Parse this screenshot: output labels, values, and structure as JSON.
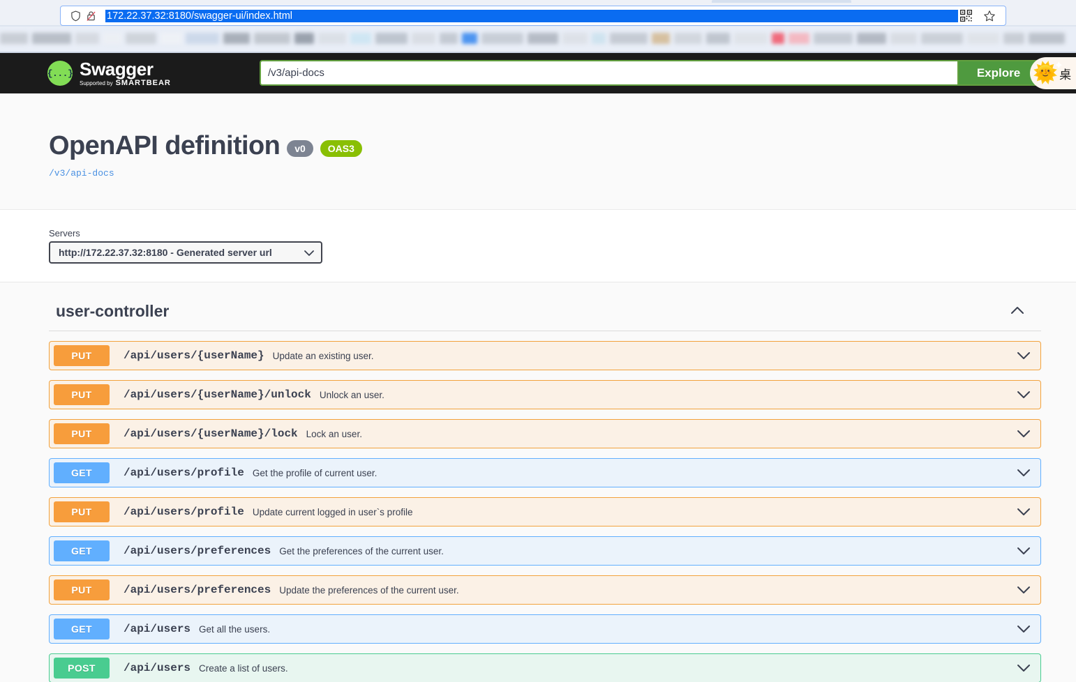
{
  "browser": {
    "url": "172.22.37.32:8180/swagger-ui/index.html",
    "shield_icon": "shield-icon",
    "lock_disabled_icon": "lock-disabled-icon",
    "qr_icon": "qr-code-icon",
    "bookmark_icon": "star-icon"
  },
  "topbar": {
    "logo_glyph": "{...}",
    "logo_title": "Swagger",
    "logo_sub_prefix": "Supported by",
    "logo_sub_brand": "SMARTBEAR",
    "explore_value": "/v3/api-docs",
    "explore_placeholder": "/v3/api-docs",
    "explore_button": "Explore",
    "emoji_sun": "🌞",
    "emoji_sparkle": "✦",
    "emoji_cjk": "桌"
  },
  "info": {
    "title": "OpenAPI definition",
    "version_badge": "v0",
    "oas_badge": "OAS3",
    "docs_link": "/v3/api-docs"
  },
  "servers": {
    "label": "Servers",
    "selected": "http://172.22.37.32:8180 - Generated server url",
    "options": [
      "http://172.22.37.32:8180 - Generated server url"
    ]
  },
  "operations_section": {
    "tag": "user-controller",
    "collapse_icon": "chevron-up-icon",
    "rows": [
      {
        "method": "PUT",
        "cls": "put",
        "path": "/api/users/{userName}",
        "summary": "Update an existing user.",
        "caret": "chevron-down-icon"
      },
      {
        "method": "PUT",
        "cls": "put",
        "path": "/api/users/{userName}/unlock",
        "summary": "Unlock an user.",
        "caret": "chevron-down-icon"
      },
      {
        "method": "PUT",
        "cls": "put",
        "path": "/api/users/{userName}/lock",
        "summary": "Lock an user.",
        "caret": "chevron-down-icon"
      },
      {
        "method": "GET",
        "cls": "get",
        "path": "/api/users/profile",
        "summary": "Get the profile of current user.",
        "caret": "chevron-down-icon"
      },
      {
        "method": "PUT",
        "cls": "put",
        "path": "/api/users/profile",
        "summary": "Update current logged in user`s profile",
        "caret": "chevron-down-icon"
      },
      {
        "method": "GET",
        "cls": "get",
        "path": "/api/users/preferences",
        "summary": "Get the preferences of the current user.",
        "caret": "chevron-down-icon"
      },
      {
        "method": "PUT",
        "cls": "put",
        "path": "/api/users/preferences",
        "summary": "Update the preferences of the current user.",
        "caret": "chevron-down-icon"
      },
      {
        "method": "GET",
        "cls": "get",
        "path": "/api/users",
        "summary": "Get all the users.",
        "caret": "chevron-down-icon"
      },
      {
        "method": "POST",
        "cls": "post",
        "path": "/api/users",
        "summary": "Create a list of users.",
        "caret": "chevron-down-icon"
      }
    ]
  },
  "colors": {
    "get": "#61affe",
    "post": "#49cc90",
    "put": "#f79d3c",
    "oas_green": "#89bf04",
    "version_gray": "#7d8492",
    "topbar_bg": "#1b1b1b",
    "explore_green": "#4f9a3f",
    "link_blue": "#4990e2"
  }
}
